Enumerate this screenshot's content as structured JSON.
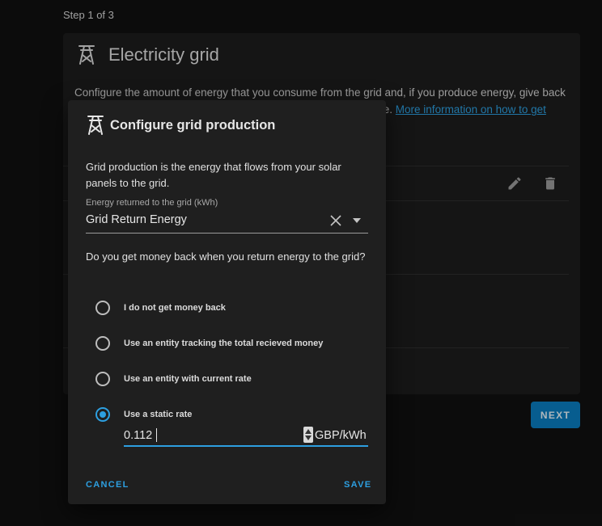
{
  "step": "Step 1 of 3",
  "card": {
    "title": "Electricity grid",
    "description": "Configure the amount of energy that you consume from the grid and, if you produce energy, give back to the",
    "description_tail": "sage.",
    "link": "More information on how to get",
    "icon": "transmission-tower-icon"
  },
  "next_label": "NEXT",
  "dialog": {
    "title": "Configure grid production",
    "icon": "transmission-tower-icon",
    "description": "Grid production is the energy that flows from your solar panels to the grid.",
    "field": {
      "label": "Energy returned to the grid (kWh)",
      "value": "Grid Return Energy"
    },
    "question": "Do you get money back when you return energy to the grid?",
    "options": [
      {
        "label": "I do not get money back",
        "checked": false
      },
      {
        "label": "Use an entity tracking the total recieved money",
        "checked": false
      },
      {
        "label": "Use an entity with current rate",
        "checked": false
      },
      {
        "label": "Use a static rate",
        "checked": true
      }
    ],
    "rate": {
      "value": "0.112",
      "unit": "GBP/kWh"
    },
    "cancel_label": "CANCEL",
    "save_label": "SAVE"
  },
  "colors": {
    "accent": "#2d9fe0",
    "primary_button": "#0a7dbf",
    "dialog_bg": "#1f1f1f"
  }
}
